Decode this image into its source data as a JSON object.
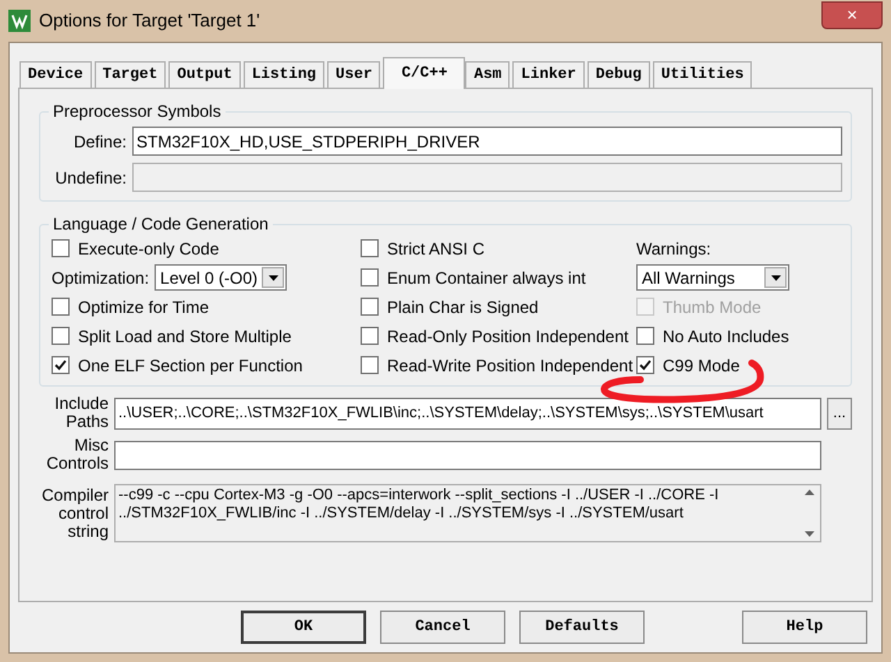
{
  "window": {
    "title": "Options for Target 'Target 1'",
    "close": "×"
  },
  "tabs": [
    {
      "label": "Device",
      "selected": false
    },
    {
      "label": "Target",
      "selected": false
    },
    {
      "label": "Output",
      "selected": false
    },
    {
      "label": "Listing",
      "selected": false
    },
    {
      "label": "User",
      "selected": false
    },
    {
      "label": "C/C++",
      "selected": true
    },
    {
      "label": "Asm",
      "selected": false
    },
    {
      "label": "Linker",
      "selected": false
    },
    {
      "label": "Debug",
      "selected": false
    },
    {
      "label": "Utilities",
      "selected": false
    }
  ],
  "preprocessor": {
    "title": "Preprocessor Symbols",
    "define": {
      "label": "Define:",
      "value": "STM32F10X_HD,USE_STDPERIPH_DRIVER",
      "disabled": false
    },
    "undefine": {
      "label": "Undefine:",
      "disabled": true
    }
  },
  "code_generation": {
    "title": "Language / Code Generation",
    "columns": [
      [
        {
          "kind": "checkbox",
          "label": "Execute-only Code",
          "checked": false,
          "disabled": false
        },
        {
          "kind": "select",
          "label": "Optimization:",
          "value": "Level 0 (-O0)"
        },
        {
          "kind": "checkbox",
          "label": "Optimize for Time",
          "checked": false,
          "disabled": false
        },
        {
          "kind": "checkbox",
          "label": "Split Load and Store Multiple",
          "checked": false,
          "disabled": false
        },
        {
          "kind": "checkbox",
          "label": "One ELF Section per Function",
          "checked": true,
          "disabled": false
        }
      ],
      [
        {
          "kind": "checkbox",
          "label": "Strict ANSI C",
          "checked": false,
          "disabled": false
        },
        {
          "kind": "checkbox",
          "label": "Enum Container always int",
          "checked": false,
          "disabled": false
        },
        {
          "kind": "checkbox",
          "label": "Plain Char is Signed",
          "checked": false,
          "disabled": false
        },
        {
          "kind": "checkbox",
          "label": "Read-Only Position Independent",
          "checked": false,
          "disabled": false
        },
        {
          "kind": "checkbox",
          "label": "Read-Write Position Independent",
          "checked": false,
          "disabled": false
        }
      ],
      [
        {
          "kind": "label",
          "label": "Warnings:"
        },
        {
          "kind": "select",
          "value": "All Warnings"
        },
        {
          "kind": "checkbox",
          "label": "Thumb Mode",
          "checked": false,
          "disabled": true
        },
        {
          "kind": "checkbox",
          "label": "No Auto Includes",
          "checked": false,
          "disabled": false
        },
        {
          "kind": "checkbox",
          "label": "C99 Mode",
          "checked": true,
          "disabled": false
        }
      ]
    ]
  },
  "include_paths": {
    "label": "Include Paths",
    "value": "..\\USER;..\\CORE;..\\STM32F10X_FWLIB\\inc;..\\SYSTEM\\delay;..\\SYSTEM\\sys;..\\SYSTEM\\usart",
    "browse": "..."
  },
  "misc_controls": {
    "label": "Misc Controls"
  },
  "compiler_string": {
    "label": "Compiler control string",
    "lines": [
      "--c99 -c --cpu Cortex-M3 -g -O0 --apcs=interwork --split_sections -I ../USER -I ../CORE -I",
      "../STM32F10X_FWLIB/inc -I ../SYSTEM/delay -I ../SYSTEM/sys -I ../SYSTEM/usart"
    ]
  },
  "buttons": [
    {
      "label": "OK",
      "default": true
    },
    {
      "label": "Cancel",
      "default": false
    },
    {
      "label": "Defaults",
      "default": false
    },
    {
      "label": "Help",
      "default": false
    }
  ]
}
